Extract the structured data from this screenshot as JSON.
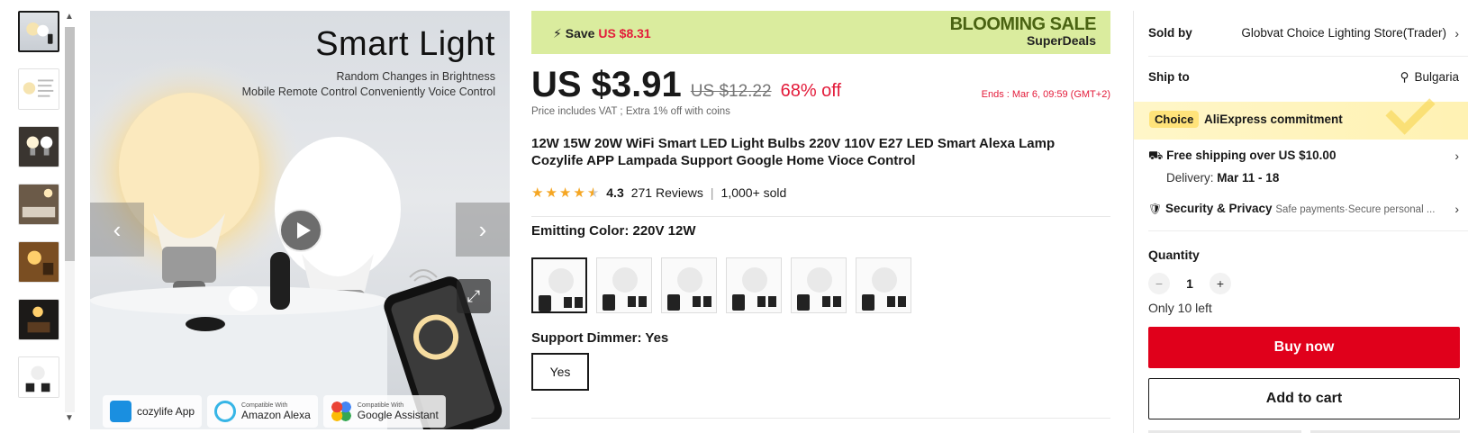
{
  "gallery": {
    "thumbnails": [
      "thumb-1",
      "thumb-2",
      "thumb-3",
      "thumb-4",
      "thumb-5",
      "thumb-6",
      "thumb-7"
    ],
    "main": {
      "title": "Smart Light",
      "line1": "Random Changes in Brightness",
      "line2": "Mobile Remote Control Conveniently Voice Control",
      "badges": [
        {
          "small": "",
          "label": "cozylife App"
        },
        {
          "small": "Compatible With",
          "label": "Amazon Alexa"
        },
        {
          "small": "Compatible With",
          "label": "Google Assistant"
        }
      ]
    }
  },
  "banner": {
    "save_prefix": "Save",
    "save_amount": "US $8.31",
    "sale_title": "BLOOMING SALE",
    "sale_subtitle": "SuperDeals"
  },
  "pricing": {
    "price": "US $3.91",
    "old_price": "US $12.22",
    "discount": "68% off",
    "ends": "Ends :  Mar 6, 09:59 (GMT+2)",
    "vat_note": "Price includes VAT ; Extra 1% off with coins"
  },
  "product": {
    "title": "12W 15W 20W WiFi Smart LED Light Bulbs 220V 110V E27 LED Smart Alexa Lamp Cozylife APP Lampada Support Google Home Vioce Control",
    "rating": "4.3",
    "rating_fraction": 0.86,
    "reviews": "271 Reviews",
    "sold": "1,000+ sold"
  },
  "sku": {
    "color_label": "Emitting Color: 220V 12W",
    "variant_count_shown": 6,
    "dimmer_label": "Support Dimmer: Yes",
    "dimmer_option": "Yes"
  },
  "sidebar": {
    "sold_by_label": "Sold by",
    "sold_by_value": "Globvat Choice Lighting Store(Trader)",
    "ship_to_label": "Ship to",
    "ship_to_value": "Bulgaria",
    "choice_tag": "Choice",
    "commitment": "AliExpress commitment",
    "free_shipping": "Free shipping over US $10.00",
    "delivery_label": "Delivery:",
    "delivery_value": "Mar 11 - 18",
    "security_label": "Security & Privacy",
    "security_text": "Safe payments·Secure personal ...",
    "quantity_label": "Quantity",
    "quantity_value": "1",
    "stock_note": "Only 10 left",
    "buy_now": "Buy now",
    "add_to_cart": "Add to cart"
  },
  "colors": {
    "accent_red": "#e0001b",
    "sale_green": "#daec9e",
    "star": "#f5a623"
  }
}
